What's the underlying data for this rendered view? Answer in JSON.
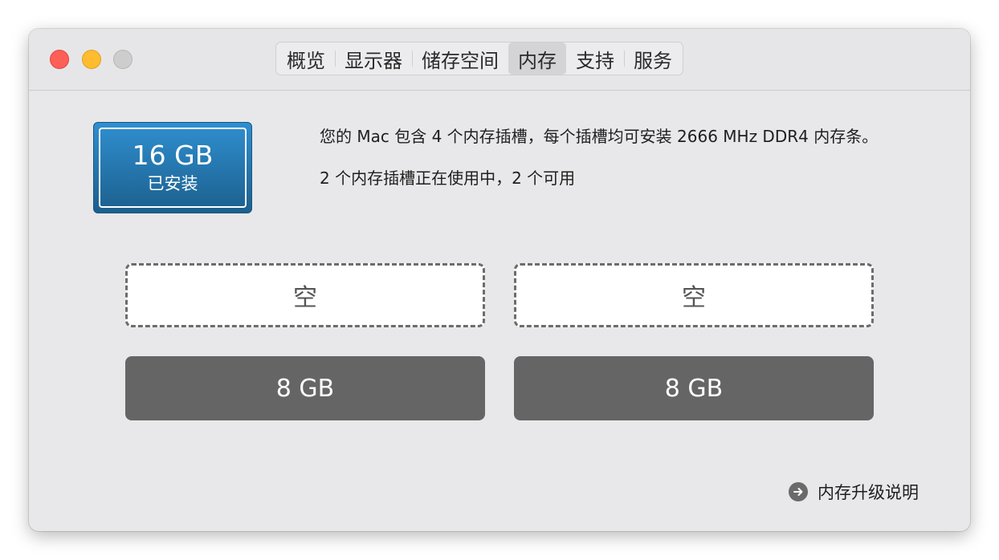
{
  "window": {
    "tabs": [
      {
        "label": "概览"
      },
      {
        "label": "显示器"
      },
      {
        "label": "储存空间"
      },
      {
        "label": "内存"
      },
      {
        "label": "支持"
      },
      {
        "label": "服务"
      }
    ],
    "active_tab": "内存"
  },
  "memory": {
    "installed_size": "16 GB",
    "installed_label": "已安装",
    "info_line_1": "您的 Mac 包含 4 个内存插槽，每个插槽均可安装 2666 MHz DDR4 内存条。",
    "info_line_2": "2 个内存插槽正在使用中，2 个可用",
    "slots": [
      {
        "label": "空",
        "state": "empty"
      },
      {
        "label": "空",
        "state": "empty"
      },
      {
        "label": "8 GB",
        "state": "filled"
      },
      {
        "label": "8 GB",
        "state": "filled"
      }
    ],
    "upgrade_link": "内存升级说明"
  },
  "colors": {
    "badge_top": "#2f8fcf",
    "badge_bottom": "#1c5f8d",
    "filled_slot": "#656565",
    "close": "#fe5f57",
    "minimize": "#febc2e",
    "zoom_disabled": "#cdcdcd"
  },
  "icons": {
    "upgrade_link_icon": "arrow-right-circle-icon"
  }
}
